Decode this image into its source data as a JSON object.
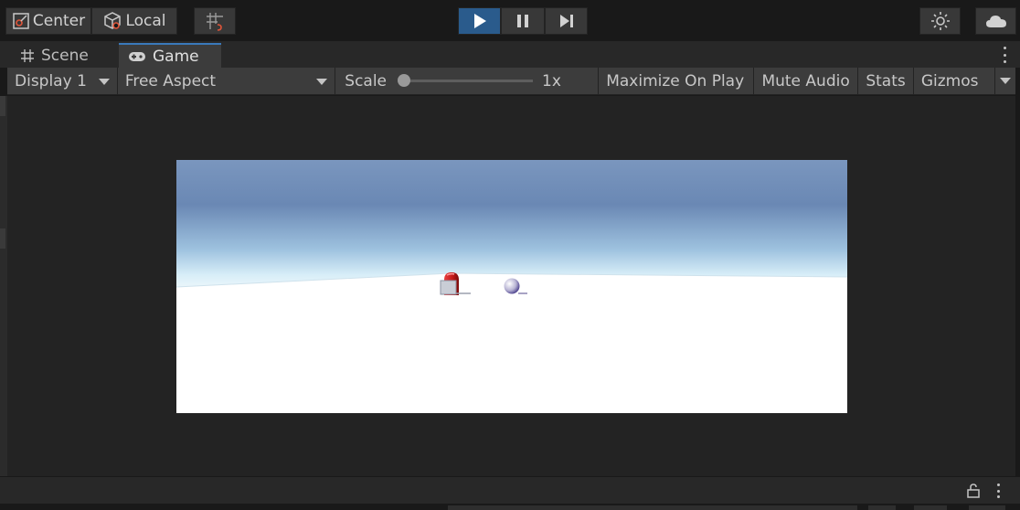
{
  "toolbar": {
    "pivot_label": "Center",
    "space_label": "Local",
    "icons": [
      "pivot-icon",
      "local-space-icon",
      "grid-snap-icon",
      "play-icon",
      "pause-icon",
      "step-icon",
      "lighting-icon",
      "cloud-icon"
    ],
    "play_active_color": "#2a5b8c"
  },
  "tabs": [
    {
      "label": "Scene",
      "icon": "hash-icon"
    },
    {
      "label": "Game",
      "icon": "gamepad-icon",
      "active": true
    }
  ],
  "game_toolbar": {
    "display": "Display 1",
    "aspect": "Free Aspect",
    "scale_label": "Scale",
    "scale_value": "1x",
    "scale_level": 0.0,
    "maximize_on_play": "Maximize On Play",
    "mute_audio": "Mute Audio",
    "stats": "Stats",
    "gizmos": "Gizmos"
  },
  "game_view": {
    "sky_top_color": "#6a88b4",
    "horizon_color": "#d8eef8",
    "ground_color": "#ffffff",
    "objects": [
      "red-capsule",
      "grey-cube",
      "purple-sphere"
    ]
  }
}
